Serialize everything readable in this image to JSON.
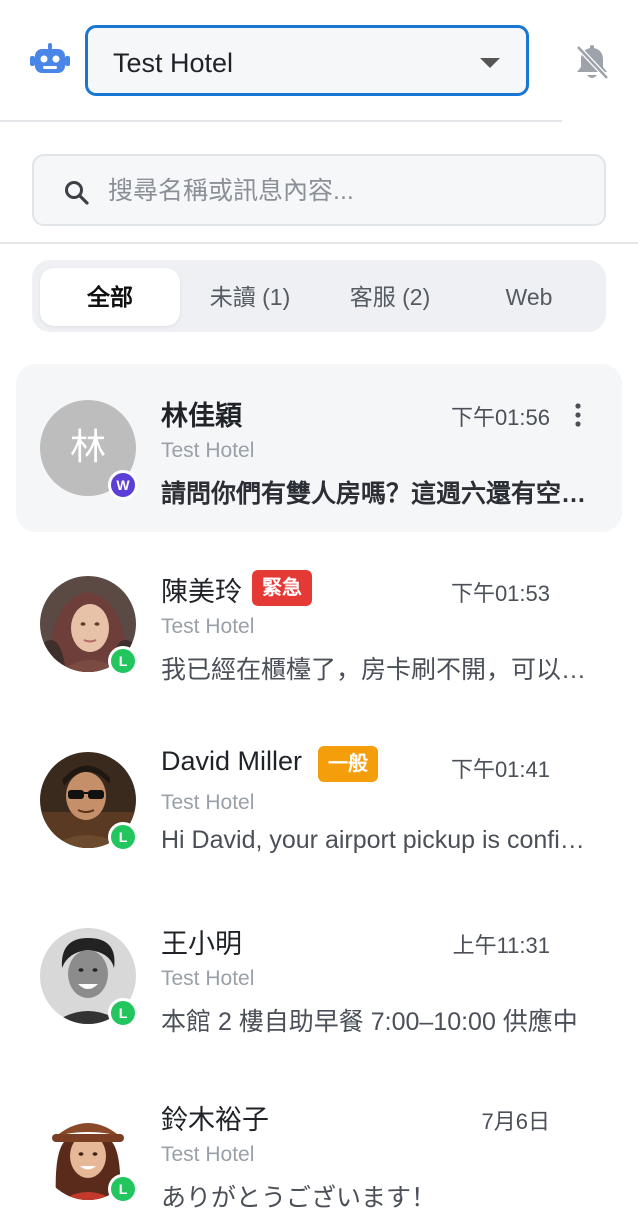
{
  "header": {
    "hotel_select_value": "Test Hotel",
    "icons": [
      "robot-icon",
      "caret-down-icon",
      "bell-off-icon"
    ]
  },
  "search": {
    "placeholder": "搜尋名稱或訊息內容..."
  },
  "tabs": [
    {
      "label": "全部",
      "active": true
    },
    {
      "label": "未讀 (1)",
      "active": false
    },
    {
      "label": "客服 (2)",
      "active": false
    },
    {
      "label": "Web",
      "active": false
    }
  ],
  "conversations": [
    {
      "name": "林佳穎",
      "avatar_letter": "林",
      "hotel": "Test Hotel",
      "time": "下午01:56",
      "preview": "請問你們有雙人房嗎？這週六還有空房嗎？",
      "channel": "W",
      "tag": "",
      "unread": true,
      "selected": true
    },
    {
      "name": "陳美玲",
      "hotel": "Test Hotel",
      "time": "下午01:53",
      "preview": "我已經在櫃檯了，房卡刷不開，可以幫忙嗎？",
      "channel": "L",
      "tag": "緊急",
      "unread": false,
      "selected": false
    },
    {
      "name": "David Miller",
      "hotel": "Test Hotel",
      "time": "下午01:41",
      "preview": "Hi David, your airport pickup is confirmed.",
      "channel": "L",
      "tag": "一般",
      "unread": false,
      "selected": false
    },
    {
      "name": "王小明",
      "hotel": "Test Hotel",
      "time": "上午11:31",
      "preview": "本館 2 樓自助早餐 7:00–10:00 供應中",
      "channel": "L",
      "tag": "",
      "unread": false,
      "selected": false
    },
    {
      "name": "鈴木裕子",
      "hotel": "Test Hotel",
      "time": "7月6日",
      "preview": "ありがとうございます！",
      "channel": "L",
      "tag": "",
      "unread": false,
      "selected": false
    }
  ],
  "colors": {
    "accent": "#1976d2",
    "web_badge": "#5b3fd6",
    "line_badge": "#22c55e",
    "urgent_tag": "#e53935",
    "normal_tag": "#f59e0b"
  }
}
